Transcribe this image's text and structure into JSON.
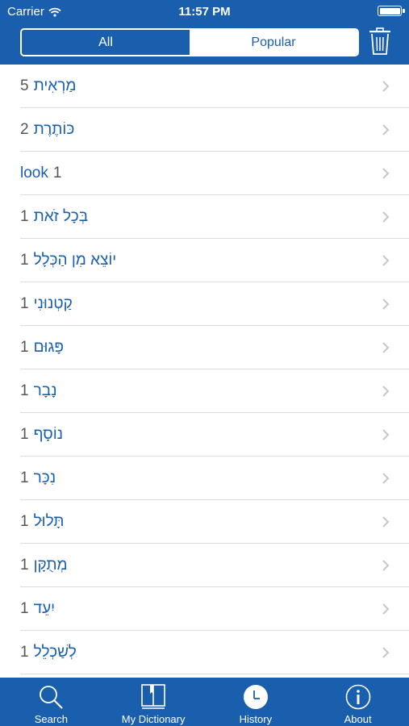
{
  "status_bar": {
    "carrier": "Carrier",
    "time": "11:57 PM"
  },
  "segments": [
    {
      "label": "All",
      "active": true
    },
    {
      "label": "Popular",
      "active": false
    }
  ],
  "history": [
    {
      "word": "מַרְאִית",
      "count": "5"
    },
    {
      "word": "כּוֹתֶרֶת",
      "count": "2"
    },
    {
      "word": "look",
      "count": "1",
      "ltr": true
    },
    {
      "word": "בְּכָל זֹאת",
      "count": "1"
    },
    {
      "word": "יוֹצֵא מִן הַכְּלָל",
      "count": "1"
    },
    {
      "word": "קַטְנוּנִי",
      "count": "1"
    },
    {
      "word": "פָּגוּם",
      "count": "1"
    },
    {
      "word": "נָבָר",
      "count": "1"
    },
    {
      "word": "נוֹסָף",
      "count": "1"
    },
    {
      "word": "נִכָּר",
      "count": "1"
    },
    {
      "word": "תָּלוּל",
      "count": "1"
    },
    {
      "word": "מְתֻקָּן",
      "count": "1"
    },
    {
      "word": "יִעֵד",
      "count": "1"
    },
    {
      "word": "לְשַׁכְלֵל",
      "count": "1"
    }
  ],
  "tabs": [
    {
      "label": "Search",
      "icon": "search-icon",
      "active": false
    },
    {
      "label": "My Dictionary",
      "icon": "book-icon",
      "active": false
    },
    {
      "label": "History",
      "icon": "clock-icon",
      "active": true
    },
    {
      "label": "About",
      "icon": "info-icon",
      "active": false
    }
  ],
  "colors": {
    "accent": "#1a5fae",
    "count_text": "#555555",
    "separator": "#dcdcdc",
    "chevron": "#c7c7cc"
  }
}
